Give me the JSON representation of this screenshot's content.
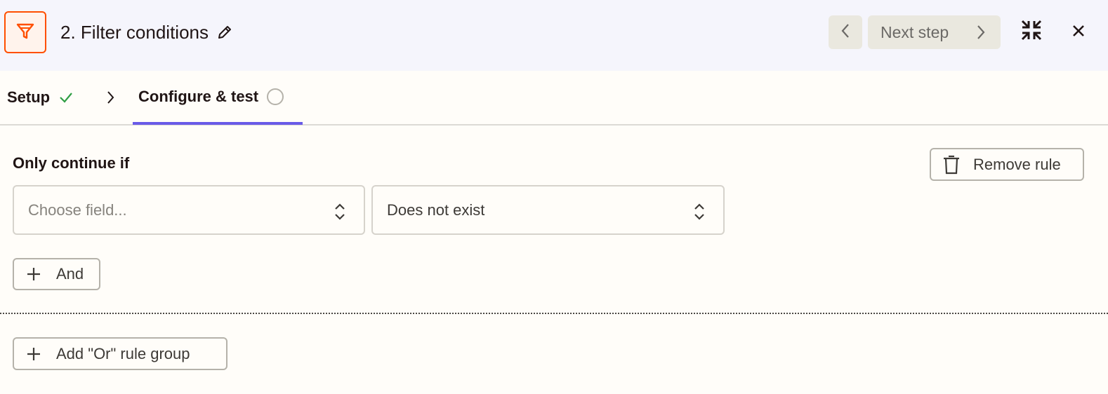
{
  "header": {
    "app_icon": "filter-icon",
    "step_title": "2. Filter conditions",
    "edit_icon": "pencil-icon",
    "prev_icon": "chevron-left-icon",
    "next_label": "Next step",
    "next_icon": "chevron-right-icon",
    "collapse_icon": "collapse-icon",
    "close_icon": "close-icon",
    "accent_color": "#ff4f00",
    "background": "#f5f5fc"
  },
  "tabs": {
    "items": [
      {
        "label": "Setup",
        "status": "complete",
        "status_icon": "check-icon"
      },
      {
        "label": "Configure & test",
        "status": "incomplete",
        "status_icon": "empty-circle-icon",
        "active": true
      }
    ],
    "separator_icon": "chevron-right-icon",
    "active_color": "#695be8",
    "complete_color": "#2f9e44"
  },
  "rule_group": {
    "label": "Only continue if",
    "remove_label": "Remove rule",
    "remove_icon": "trash-icon",
    "field_select": {
      "placeholder": "Choose field...",
      "value": ""
    },
    "operator_select": {
      "value": "Does not exist"
    },
    "select_icon": "up-down-chevron-icon",
    "and_label": "And",
    "and_icon": "plus-icon"
  },
  "or_group": {
    "label": "Add \"Or\" rule group",
    "icon": "plus-icon"
  }
}
